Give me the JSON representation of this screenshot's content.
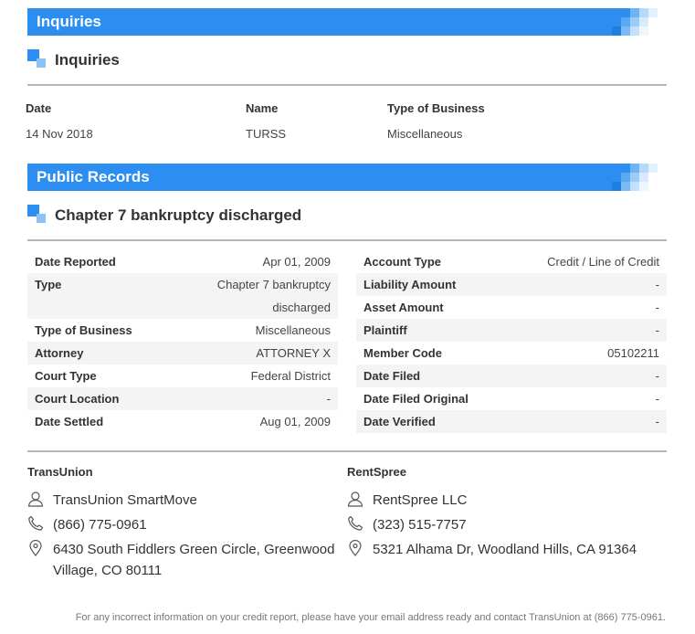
{
  "inquiries_section": {
    "bar_title": "Inquiries",
    "sub_title": "Inquiries"
  },
  "inquiries_table": {
    "headers": {
      "date": "Date",
      "name": "Name",
      "type": "Type of Business"
    },
    "row": {
      "date": "14 Nov 2018",
      "name": "TURSS",
      "type": "Miscellaneous"
    }
  },
  "public_records_section": {
    "bar_title": "Public Records",
    "sub_title": "Chapter 7 bankruptcy discharged"
  },
  "record_left": [
    {
      "label": "Date Reported",
      "value": "Apr 01, 2009"
    },
    {
      "label": "Type",
      "value": "Chapter 7 bankruptcy discharged"
    },
    {
      "label": "Type of Business",
      "value": "Miscellaneous"
    },
    {
      "label": "Attorney",
      "value": "ATTORNEY X"
    },
    {
      "label": "Court Type",
      "value": "Federal District"
    },
    {
      "label": "Court Location",
      "value": "-"
    },
    {
      "label": "Date Settled",
      "value": "Aug 01, 2009"
    }
  ],
  "record_right": [
    {
      "label": "Account Type",
      "value": "Credit / Line of Credit"
    },
    {
      "label": "Liability Amount",
      "value": "-"
    },
    {
      "label": "Asset Amount",
      "value": "-"
    },
    {
      "label": "Plaintiff",
      "value": "-"
    },
    {
      "label": "Member Code",
      "value": "05102211"
    },
    {
      "label": "Date Filed",
      "value": "-"
    },
    {
      "label": "Date Filed Original",
      "value": "-"
    },
    {
      "label": "Date Verified",
      "value": "-"
    }
  ],
  "contacts": [
    {
      "heading": "TransUnion",
      "name": "TransUnion SmartMove",
      "phone": "(866) 775-0961",
      "address_line1": "6430 South Fiddlers Green Circle, Greenwood",
      "address_line2": "Village, CO 80111"
    },
    {
      "heading": "RentSpree",
      "name": "RentSpree LLC",
      "phone": "(323) 515-7757",
      "address_line1": "5321 Alhama Dr, Woodland Hills, CA 91364",
      "address_line2": ""
    }
  ],
  "footer_text": "For any incorrect information on your credit report, please have your email address ready and contact TransUnion at (866) 775-0961.",
  "icons": {
    "person": "person-icon",
    "phone": "phone-icon",
    "location": "location-pin-icon"
  },
  "colors": {
    "accent": "#2b8ef0",
    "accent_light": "#a9cff7",
    "divider": "#b5b5b5",
    "row_shade": "#f4f4f4"
  }
}
